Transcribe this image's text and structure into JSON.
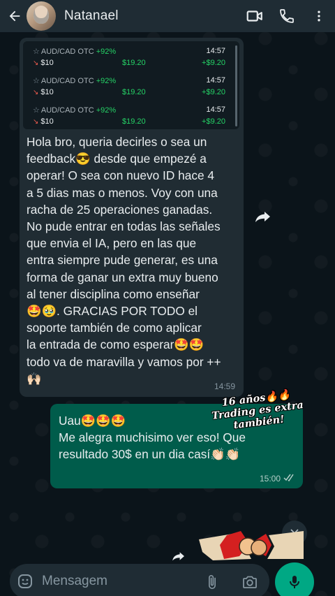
{
  "header": {
    "contact_name": "Natanael"
  },
  "quoted_trades": [
    {
      "pair": "AUD/CAD OTC",
      "percent": "+92%",
      "time": "14:57",
      "amount": "$10",
      "payout": "$19.20",
      "profit": "+$9.20"
    },
    {
      "pair": "AUD/CAD OTC",
      "percent": "+92%",
      "time": "14:57",
      "amount": "$10",
      "payout": "$19.20",
      "profit": "+$9.20"
    },
    {
      "pair": "AUD/CAD OTC",
      "percent": "+92%",
      "time": "14:57",
      "amount": "$10",
      "payout": "$19.20",
      "profit": "+$9.20"
    }
  ],
  "incoming_message": {
    "text": "Hola bro, queria decirles o sea un\nfeedback😎 desde que empezé a\noperar! O sea con nuevo ID hace 4\na 5 dias mas o menos. Voy con una\nracha de 25 operaciones ganadas.\nNo pude entrar en todas las señales\nque envia el IA, pero en las que\nentra siempre pude generar, es una\nforma de ganar un extra muy bueno\nal tener disciplina como enseñar\n🤩🥹. GRACIAS POR TODO el\nsoporte también de como aplicar\nla entrada de como esperar🤩🤩\ntodo va de maravilla y vamos por ++\n🙌🏻",
    "time": "14:59"
  },
  "outgoing_message": {
    "text": "Uau🤩🤩🤩\nMe alegra muchisimo ver eso! Que\nresultado 30$ en un dia casí👏🏻👏🏻",
    "time": "15:00"
  },
  "sticker_caption": "16 años🔥🔥\nTrading es extra\ntambién!",
  "input": {
    "placeholder": "Mensagem"
  },
  "colors": {
    "header_bg": "#1f2c34",
    "incoming_bg": "#202c33",
    "outgoing_bg": "#005c4b",
    "accent": "#00a884"
  },
  "icons": [
    "back-arrow-icon",
    "video-call-icon",
    "phone-icon",
    "more-vert-icon",
    "forward-icon",
    "chevron-double-down-icon",
    "emoji-icon",
    "attach-icon",
    "camera-icon",
    "mic-icon",
    "double-check-icon",
    "star-icon",
    "arrow-down-icon"
  ]
}
